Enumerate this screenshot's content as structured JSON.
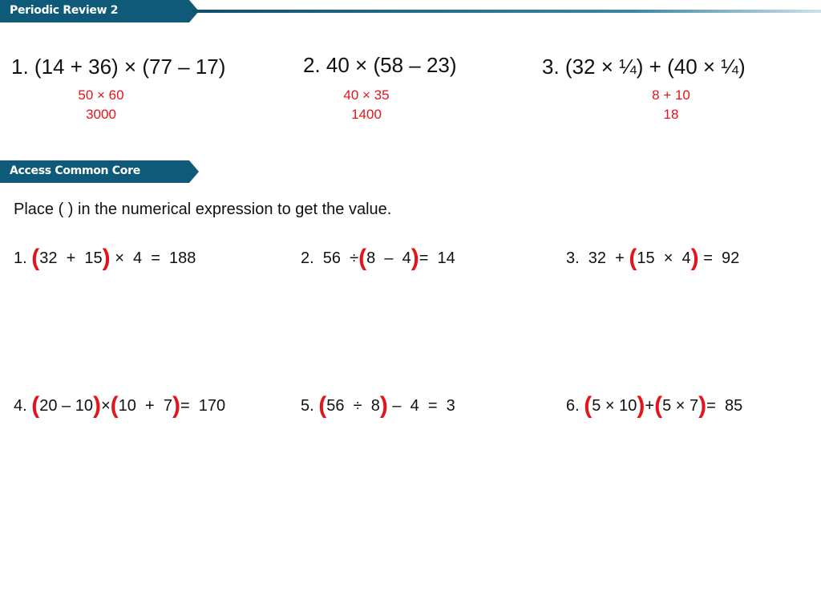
{
  "header1": {
    "title": "Periodic Review 2"
  },
  "header2": {
    "title": "Access Common Core"
  },
  "colors": {
    "banner": "#0f5a78",
    "answer": "#e4141b"
  },
  "review": [
    {
      "expr": "1.  (14 + 36) × (77 – 17)",
      "answer": [
        "50 × 60",
        "3000"
      ]
    },
    {
      "expr": "2.  40 × (58 – 23)",
      "answer": [
        "40 × 35",
        "1400"
      ]
    },
    {
      "expr": "3.  (32 × ¼) + (40 × ¼)",
      "answer": [
        "8 + 10",
        "18"
      ]
    }
  ],
  "instruction": "Place (  ) in the numerical expression to get the value.",
  "problems": [
    {
      "tokens": [
        {
          "t": "1. "
        },
        {
          "t": "(",
          "p": 1
        },
        {
          "t": "32  +  15"
        },
        {
          "t": ")",
          "p": 1
        },
        {
          "t": " ×  4  =  188"
        }
      ]
    },
    {
      "tokens": [
        {
          "t": "2.  56  ÷"
        },
        {
          "t": "(",
          "p": 1
        },
        {
          "t": "8  –  4"
        },
        {
          "t": ")",
          "p": 1
        },
        {
          "t": "=  14"
        }
      ]
    },
    {
      "tokens": [
        {
          "t": "3.  32  + "
        },
        {
          "t": "(",
          "p": 1
        },
        {
          "t": "15  ×  4"
        },
        {
          "t": ")",
          "p": 1
        },
        {
          "t": " =  92"
        }
      ]
    },
    {
      "tokens": [
        {
          "t": "4. "
        },
        {
          "t": "(",
          "p": 1
        },
        {
          "t": "20 – 10"
        },
        {
          "t": ")",
          "p": 1
        },
        {
          "t": "×"
        },
        {
          "t": "(",
          "p": 1
        },
        {
          "t": "10  +  7"
        },
        {
          "t": ")",
          "p": 1
        },
        {
          "t": "=  170"
        }
      ]
    },
    {
      "tokens": [
        {
          "t": "5. "
        },
        {
          "t": "(",
          "p": 1
        },
        {
          "t": "56  ÷  8"
        },
        {
          "t": ")",
          "p": 1
        },
        {
          "t": " –  4  =  3"
        }
      ]
    },
    {
      "tokens": [
        {
          "t": "6. "
        },
        {
          "t": "(",
          "p": 1
        },
        {
          "t": "5 × 10"
        },
        {
          "t": ")",
          "p": 1
        },
        {
          "t": "+"
        },
        {
          "t": "(",
          "p": 1
        },
        {
          "t": "5 × 7"
        },
        {
          "t": ")",
          "p": 1
        },
        {
          "t": "=  85"
        }
      ]
    }
  ]
}
